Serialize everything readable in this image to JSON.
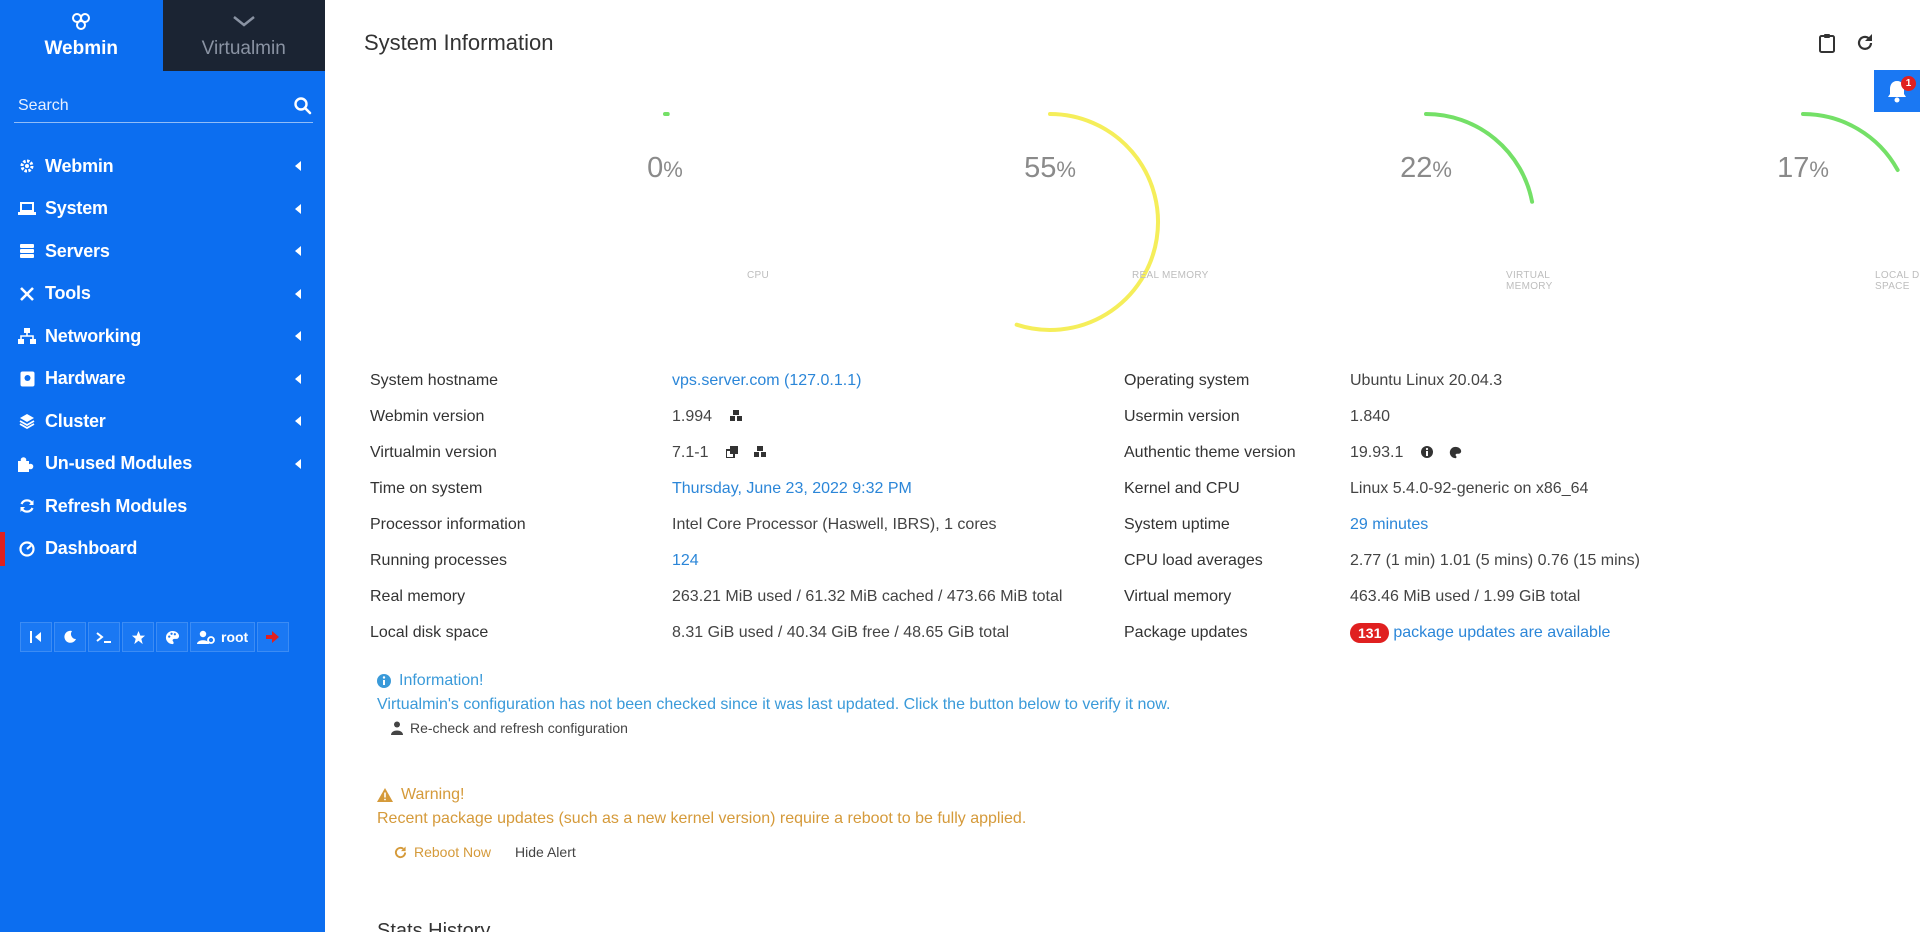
{
  "sidebar": {
    "switcher": {
      "webmin": "Webmin",
      "virtualmin": "Virtualmin"
    },
    "search_placeholder": "Search",
    "items": [
      {
        "label": "Webmin",
        "icon": "gear-icon"
      },
      {
        "label": "System",
        "icon": "laptop-icon"
      },
      {
        "label": "Servers",
        "icon": "database-icon"
      },
      {
        "label": "Tools",
        "icon": "tools-icon"
      },
      {
        "label": "Networking",
        "icon": "network-icon"
      },
      {
        "label": "Hardware",
        "icon": "disk-icon"
      },
      {
        "label": "Cluster",
        "icon": "layers-icon"
      },
      {
        "label": "Un-used Modules",
        "icon": "puzzle-icon"
      },
      {
        "label": "Refresh Modules",
        "icon": "refresh-icon"
      },
      {
        "label": "Dashboard",
        "icon": "dashboard-icon",
        "active": true
      }
    ],
    "toolbar": {
      "user": "root"
    }
  },
  "header": {
    "title": "System Information",
    "notifications": "1"
  },
  "gauges": [
    {
      "value": "0",
      "unit": "%",
      "label": "CPU",
      "percent": 0,
      "color": "#74e067"
    },
    {
      "value": "55",
      "unit": "%",
      "label": "REAL MEMORY",
      "percent": 55,
      "color": "#f5ee5a"
    },
    {
      "value": "22",
      "unit": "%",
      "label": "VIRTUAL MEMORY",
      "percent": 22,
      "color": "#74e067"
    },
    {
      "value": "17",
      "unit": "%",
      "label": "LOCAL DISK SPACE",
      "percent": 17,
      "color": "#74e067"
    }
  ],
  "info": {
    "left": [
      {
        "label": "System hostname",
        "value": "vps.server.com (127.0.1.1)"
      },
      {
        "label": "Webmin version",
        "value": "1.994"
      },
      {
        "label": "Virtualmin version",
        "value": "7.1-1"
      },
      {
        "label": "Time on system",
        "value": "Thursday, June 23, 2022 9:32 PM"
      },
      {
        "label": "Processor information",
        "value": "Intel Core Processor (Haswell, IBRS), 1 cores"
      },
      {
        "label": "Running processes",
        "value": "124"
      },
      {
        "label": "Real memory",
        "value": "263.21 MiB used / 61.32 MiB cached / 473.66 MiB total"
      },
      {
        "label": "Local disk space",
        "value": "8.31 GiB used / 40.34 GiB free / 48.65 GiB total"
      }
    ],
    "right": [
      {
        "label": "Operating system",
        "value": "Ubuntu Linux 20.04.3"
      },
      {
        "label": "Usermin version",
        "value": "1.840"
      },
      {
        "label": "Authentic theme version",
        "value": "19.93.1"
      },
      {
        "label": "Kernel and CPU",
        "value": "Linux 5.4.0-92-generic on x86_64"
      },
      {
        "label": "System uptime",
        "value": "29 minutes"
      },
      {
        "label": "CPU load averages",
        "value": "2.77 (1 min) 1.01 (5 mins) 0.76 (15 mins)"
      },
      {
        "label": "Virtual memory",
        "value": "463.46 MiB used / 1.99 GiB total"
      },
      {
        "label": "Package updates",
        "badge": "131",
        "value": "package updates are available"
      }
    ]
  },
  "alerts": {
    "info": {
      "title": "Information!",
      "message": "Virtualmin's configuration has not been checked since it was last updated. Click the button below to verify it now.",
      "button": "Re-check and refresh configuration"
    },
    "warning": {
      "title": "Warning!",
      "message": "Recent package updates (such as a new kernel version) require a reboot to be fully applied.",
      "reboot_button": "Reboot Now",
      "hide_button": "Hide Alert"
    }
  },
  "stats_history": "Stats History"
}
